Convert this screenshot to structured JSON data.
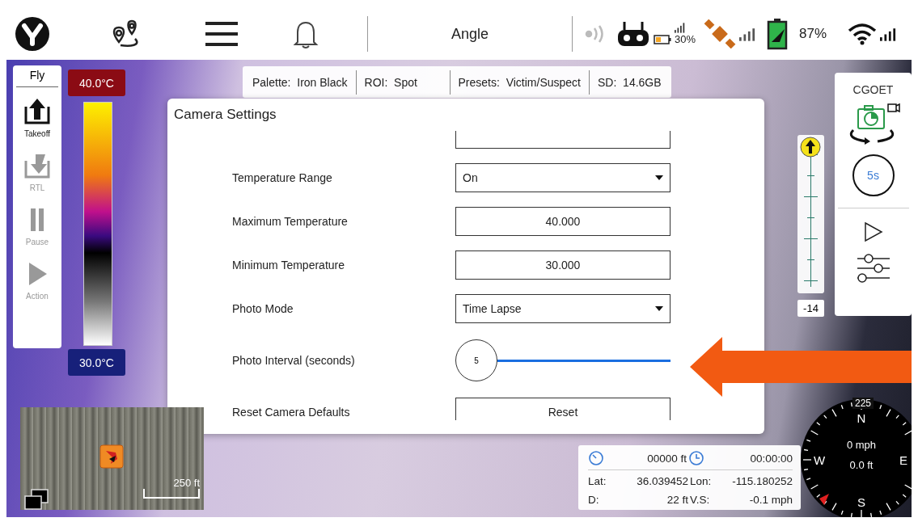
{
  "top_bar": {
    "title": "Angle",
    "controller_battery": "30%",
    "battery": "87%"
  },
  "fly_panel": {
    "title": "Fly",
    "actions": [
      {
        "kind": "takeoff",
        "label": "Takeoff",
        "disabled": false
      },
      {
        "kind": "rtl",
        "label": "RTL",
        "disabled": true
      },
      {
        "kind": "pause",
        "label": "Pause",
        "disabled": true
      },
      {
        "kind": "action",
        "label": "Action",
        "disabled": true
      }
    ]
  },
  "thermal_scale": {
    "max": "40.0°C",
    "min": "30.0°C"
  },
  "info_bar": [
    {
      "label": "Palette:",
      "value": "Iron Black"
    },
    {
      "label": "ROI:",
      "value": "Spot"
    },
    {
      "label": "Presets:",
      "value": "Victim/Suspect"
    },
    {
      "label": "SD:",
      "value": "14.6GB"
    }
  ],
  "camera_settings": {
    "title": "Camera Settings",
    "rows": [
      {
        "kind": "dropdown",
        "label": "Temperature Range",
        "value": "On"
      },
      {
        "kind": "number",
        "label": "Maximum Temperature",
        "value": "40.000"
      },
      {
        "kind": "number",
        "label": "Minimum Temperature",
        "value": "30.000"
      },
      {
        "kind": "dropdown",
        "label": "Photo Mode",
        "value": "Time Lapse"
      },
      {
        "kind": "slider",
        "label": "Photo Interval (seconds)",
        "value": "5",
        "level": 0
      },
      {
        "kind": "button",
        "label": "Reset Camera Defaults",
        "value": "Reset"
      }
    ]
  },
  "camera_panel": {
    "title": "CGOET",
    "shutter": "5s"
  },
  "altitude_slider": {
    "level": 1,
    "reading": "-14"
  },
  "map": {
    "scale": "250 ft"
  },
  "telemetry": {
    "distance": "00000 ft",
    "time": "00:00:00",
    "rows": [
      {
        "label": "Lat:",
        "value": "36.039452",
        "label_2": "Lon:",
        "value_2": "-115.180252"
      },
      {
        "label": "D:",
        "value": "22 ft",
        "label_2": "V.S:",
        "value_2": "-0.1 mph"
      }
    ]
  },
  "compass": {
    "heading": "225",
    "speed": "0 mph",
    "altitude": "0.0 ft",
    "directions": [
      "N",
      "E",
      "S",
      "W"
    ]
  }
}
